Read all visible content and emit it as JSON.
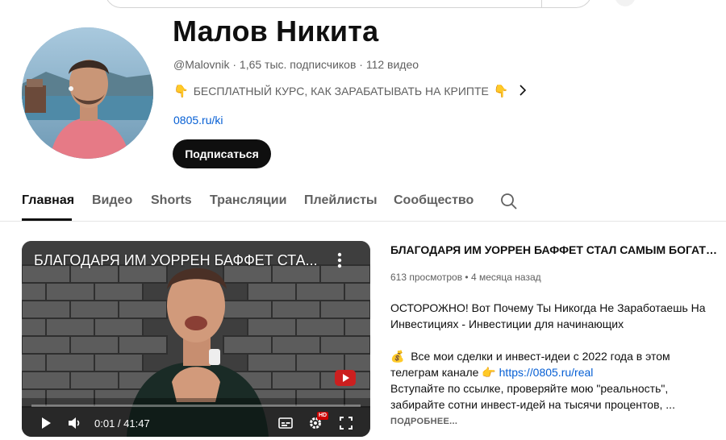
{
  "channel": {
    "name": "Малов Никита",
    "handle": "@Malovnik",
    "separator": " · ",
    "subscribers": "1,65 тыс. подписчиков",
    "videos": "112 видео",
    "description": "БЕСПЛАТНЫЙ КУРС, КАК ЗАРАБАТЫВАТЬ НА КРИПТЕ",
    "description_emoji": "👇",
    "link": "0805.ru/ki",
    "subscribe_label": "Подписаться"
  },
  "tabs": [
    {
      "label": "Главная",
      "active": true
    },
    {
      "label": "Видео",
      "active": false
    },
    {
      "label": "Shorts",
      "active": false
    },
    {
      "label": "Трансляции",
      "active": false
    },
    {
      "label": "Плейлисты",
      "active": false
    },
    {
      "label": "Сообщество",
      "active": false
    }
  ],
  "player": {
    "overlay_title": "БЛАГОДАРЯ ИМ УОРРЕН БАФФЕТ СТА...",
    "time": "0:01 / 41:47",
    "hd_label": "HD",
    "progress": 0.0004
  },
  "video": {
    "title": "БЛАГОДАРЯ ИМ УОРРЕН БАФФЕТ СТАЛ САМЫМ БОГАТЫ...",
    "views": "613 просмотров",
    "age": "4 месяца назад",
    "meta_separator": " • ",
    "desc_line1": "ОСТОРОЖНО! Вот Почему Ты Никогда Не Заработаешь На Инвестициях - Инвестиции для начинающих",
    "desc_line2_emoji": "💰",
    "desc_line2": "Все мои сделки и инвест-идеи с 2022 года в этом телеграм канале",
    "desc_line2_point": "👉",
    "desc_link": "https://0805.ru/real",
    "desc_line3": "Вступайте по ссылке, проверяйте мою \"реальность\", забирайте сотни инвест-идей на тысячи процентов, ...",
    "more_label": "ПОДРОБНЕЕ..."
  },
  "colors": {
    "link": "#065fd4",
    "subscribe_bg": "#0f0f0f",
    "secondary_text": "#606060",
    "hd_badge": "#cc0000"
  },
  "icons": [
    "search-icon",
    "chevron-right-icon",
    "play-icon",
    "volume-icon",
    "more-vert-icon",
    "subtitles-icon",
    "settings-icon",
    "fullscreen-icon",
    "youtube-logo-icon"
  ]
}
